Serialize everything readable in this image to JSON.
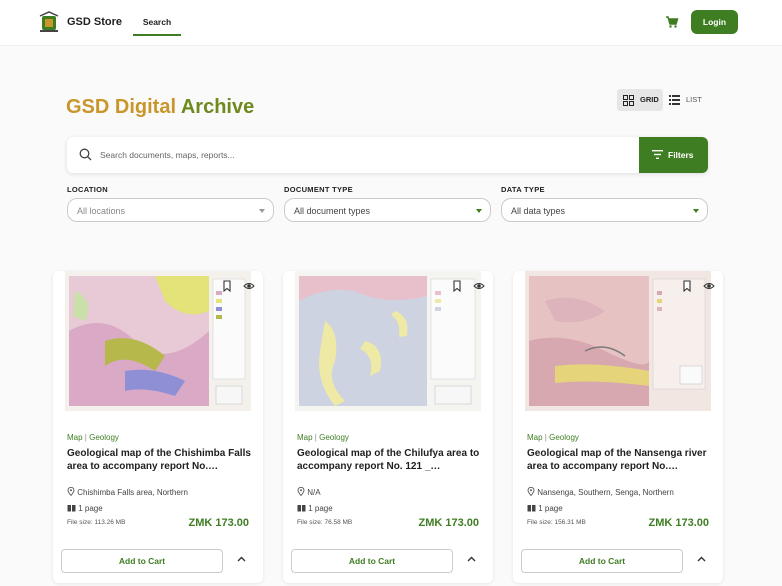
{
  "header": {
    "brand": "GSD Store",
    "nav_search": "Search",
    "login": "Login"
  },
  "page": {
    "title_part1": "GSD Digital",
    "title_part2": "Archive",
    "view_grid": "GRID",
    "view_list": "LIST",
    "search_placeholder": "Search documents, maps, reports...",
    "filters_button": "Filters"
  },
  "filters": [
    {
      "label": "LOCATION",
      "value": "All locations"
    },
    {
      "label": "DOCUMENT TYPE",
      "value": "All document types"
    },
    {
      "label": "DATA TYPE",
      "value": "All data types"
    }
  ],
  "cards": [
    {
      "type": "Map",
      "category": "Geology",
      "title": "Geological map of the Chishimba Falls area to accompany report No.…",
      "location": "Chishimba Falls area, Northern",
      "pages": "1 page",
      "size": "File size: 113.26 MB",
      "price": "ZMK 173.00",
      "add": "Add to Cart"
    },
    {
      "type": "Map",
      "category": "Geology",
      "title": "Geological map of the Chilufya area to accompany report No. 121 _…",
      "location": "N/A",
      "pages": "1 page",
      "size": "File size: 76.58 MB",
      "price": "ZMK 173.00",
      "add": "Add to Cart"
    },
    {
      "type": "Map",
      "category": "Geology",
      "title": "Geological map of the Nansenga river area to accompany report No.…",
      "location": "Nansenga, Southern, Senga, Northern",
      "pages": "1 page",
      "size": "File size: 156.31 MB",
      "price": "ZMK 173.00",
      "add": "Add to Cart"
    }
  ],
  "colors": {
    "accent": "#3f7d23",
    "title_gold": "#c9962b",
    "title_olive": "#6e8a1e"
  },
  "icons": [
    "logo-icon",
    "cart-icon",
    "grid-icon",
    "list-icon",
    "search-icon",
    "filter-icon",
    "bookmark-icon",
    "eye-icon",
    "location-pin-icon",
    "book-icon",
    "chevron-up-icon"
  ]
}
